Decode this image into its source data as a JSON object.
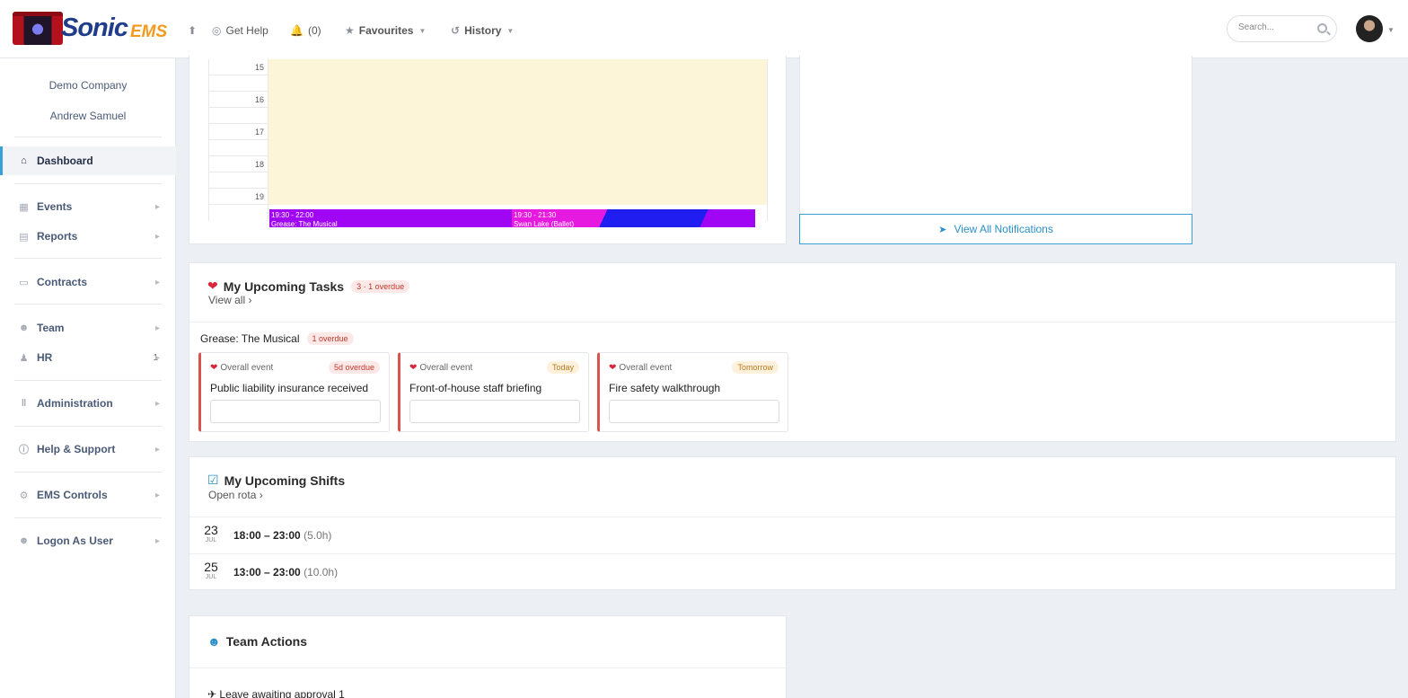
{
  "brand": {
    "name": "Sonic",
    "suffix": "EMS"
  },
  "topnav": {
    "help": "Get Help",
    "notifications": "(0)",
    "favourites": "Favourites",
    "history": "History"
  },
  "search": {
    "placeholder": "Search..."
  },
  "sidebar": {
    "company": "Demo Company",
    "user": "Andrew Samuel",
    "items": [
      {
        "label": "Dashboard",
        "icon": "home-icon"
      },
      {
        "label": "Events",
        "icon": "table-icon"
      },
      {
        "label": "Reports",
        "icon": "report-icon"
      },
      {
        "label": "Contracts",
        "icon": "document-icon"
      },
      {
        "label": "Team",
        "icon": "user-icon"
      },
      {
        "label": "HR",
        "icon": "hr-icon",
        "badge": "1"
      },
      {
        "label": "Administration",
        "icon": "sliders-icon"
      },
      {
        "label": "Help & Support",
        "icon": "help-icon"
      },
      {
        "label": "EMS Controls",
        "icon": "gear-icon"
      },
      {
        "label": "Logon As User",
        "icon": "user-switch-icon"
      }
    ]
  },
  "calendar": {
    "hours": [
      "15",
      "16",
      "17",
      "18",
      "19"
    ],
    "events": [
      {
        "time": "19:30 - 22:00",
        "title": "Grease: The Musical",
        "color": "#a006f3"
      },
      {
        "time": "19:30 - 21:30",
        "title": "Swan Lake (Ballet)",
        "color": "#e619e0"
      }
    ]
  },
  "notifications": {
    "view_all": "View All Notifications"
  },
  "tasks": {
    "title": "My Upcoming Tasks",
    "badge": "3 · 1 overdue",
    "view_all": "View all",
    "group": {
      "name": "Grease: The Musical",
      "badge": "1 overdue"
    },
    "cards": [
      {
        "scope": "Overall event",
        "due": "5d overdue",
        "name": "Public liability insurance received"
      },
      {
        "scope": "Overall event",
        "due": "Today",
        "name": "Front-of-house staff briefing"
      },
      {
        "scope": "Overall event",
        "due": "Tomorrow",
        "name": "Fire safety walkthrough"
      }
    ]
  },
  "shifts": {
    "title": "My Upcoming Shifts",
    "link": "Open rota",
    "rows": [
      {
        "day": "23",
        "month": "JUL",
        "time": "18:00 – 23:00",
        "hours": "(5.0h)"
      },
      {
        "day": "25",
        "month": "JUL",
        "time": "13:00 – 23:00",
        "hours": "(10.0h)"
      }
    ]
  },
  "team_actions": {
    "title": "Team Actions",
    "leave": "Leave awaiting approval 1"
  },
  "colors": {
    "accent": "#3aa0d8",
    "calendar_bg": "#fdf5d8",
    "danger": "#d9534f"
  }
}
